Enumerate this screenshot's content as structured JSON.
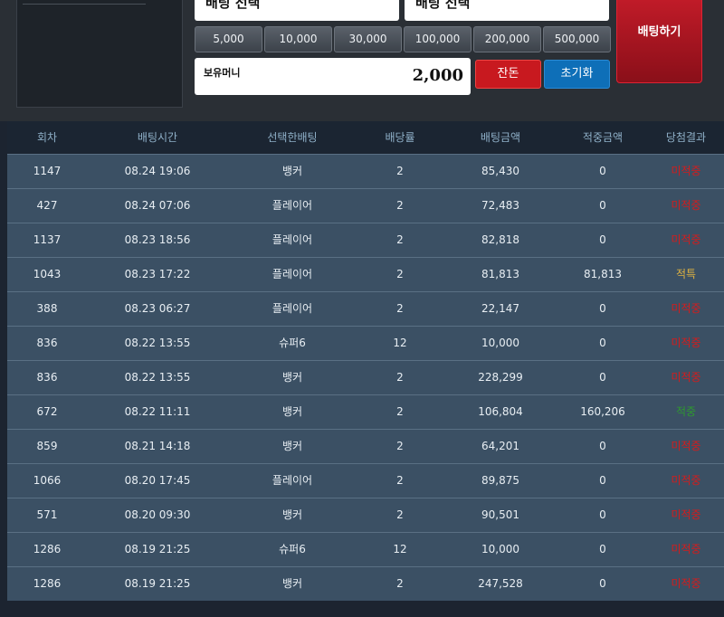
{
  "selectors": {
    "left_value": "배팅 선택",
    "right_value": "배팅 선택"
  },
  "chips": [
    "5,000",
    "10,000",
    "30,000",
    "100,000",
    "200,000",
    "500,000"
  ],
  "money": {
    "label": "보유머니",
    "value": "2,000"
  },
  "buttons": {
    "balance": "잔돈",
    "reset": "초기화",
    "bet": "배팅하기"
  },
  "table": {
    "headers": [
      "회차",
      "배팅시간",
      "선택한배팅",
      "배당률",
      "배팅금액",
      "적중금액",
      "당첨결과"
    ],
    "rows": [
      [
        "1147",
        "08.24 19:06",
        "뱅커",
        "2",
        "85,430",
        "0",
        "미적중"
      ],
      [
        "427",
        "08.24 07:06",
        "플레이어",
        "2",
        "72,483",
        "0",
        "미적중"
      ],
      [
        "1137",
        "08.23 18:56",
        "플레이어",
        "2",
        "82,818",
        "0",
        "미적중"
      ],
      [
        "1043",
        "08.23 17:22",
        "플레이어",
        "2",
        "81,813",
        "81,813",
        "적특"
      ],
      [
        "388",
        "08.23 06:27",
        "플레이어",
        "2",
        "22,147",
        "0",
        "미적중"
      ],
      [
        "836",
        "08.22 13:55",
        "슈퍼6",
        "12",
        "10,000",
        "0",
        "미적중"
      ],
      [
        "836",
        "08.22 13:55",
        "뱅커",
        "2",
        "228,299",
        "0",
        "미적중"
      ],
      [
        "672",
        "08.22 11:11",
        "뱅커",
        "2",
        "106,804",
        "160,206",
        "적중"
      ],
      [
        "859",
        "08.21 14:18",
        "뱅커",
        "2",
        "64,201",
        "0",
        "미적중"
      ],
      [
        "1066",
        "08.20 17:45",
        "플레이어",
        "2",
        "89,875",
        "0",
        "미적중"
      ],
      [
        "571",
        "08.20 09:30",
        "뱅커",
        "2",
        "90,501",
        "0",
        "미적중"
      ],
      [
        "1286",
        "08.19 21:25",
        "슈퍼6",
        "12",
        "10,000",
        "0",
        "미적중"
      ],
      [
        "1286",
        "08.19 21:25",
        "뱅커",
        "2",
        "247,528",
        "0",
        "미적중"
      ]
    ]
  },
  "colors": {
    "lose": "#d41c1c",
    "hit": "#e0b341",
    "win": "#2e9a2e"
  }
}
